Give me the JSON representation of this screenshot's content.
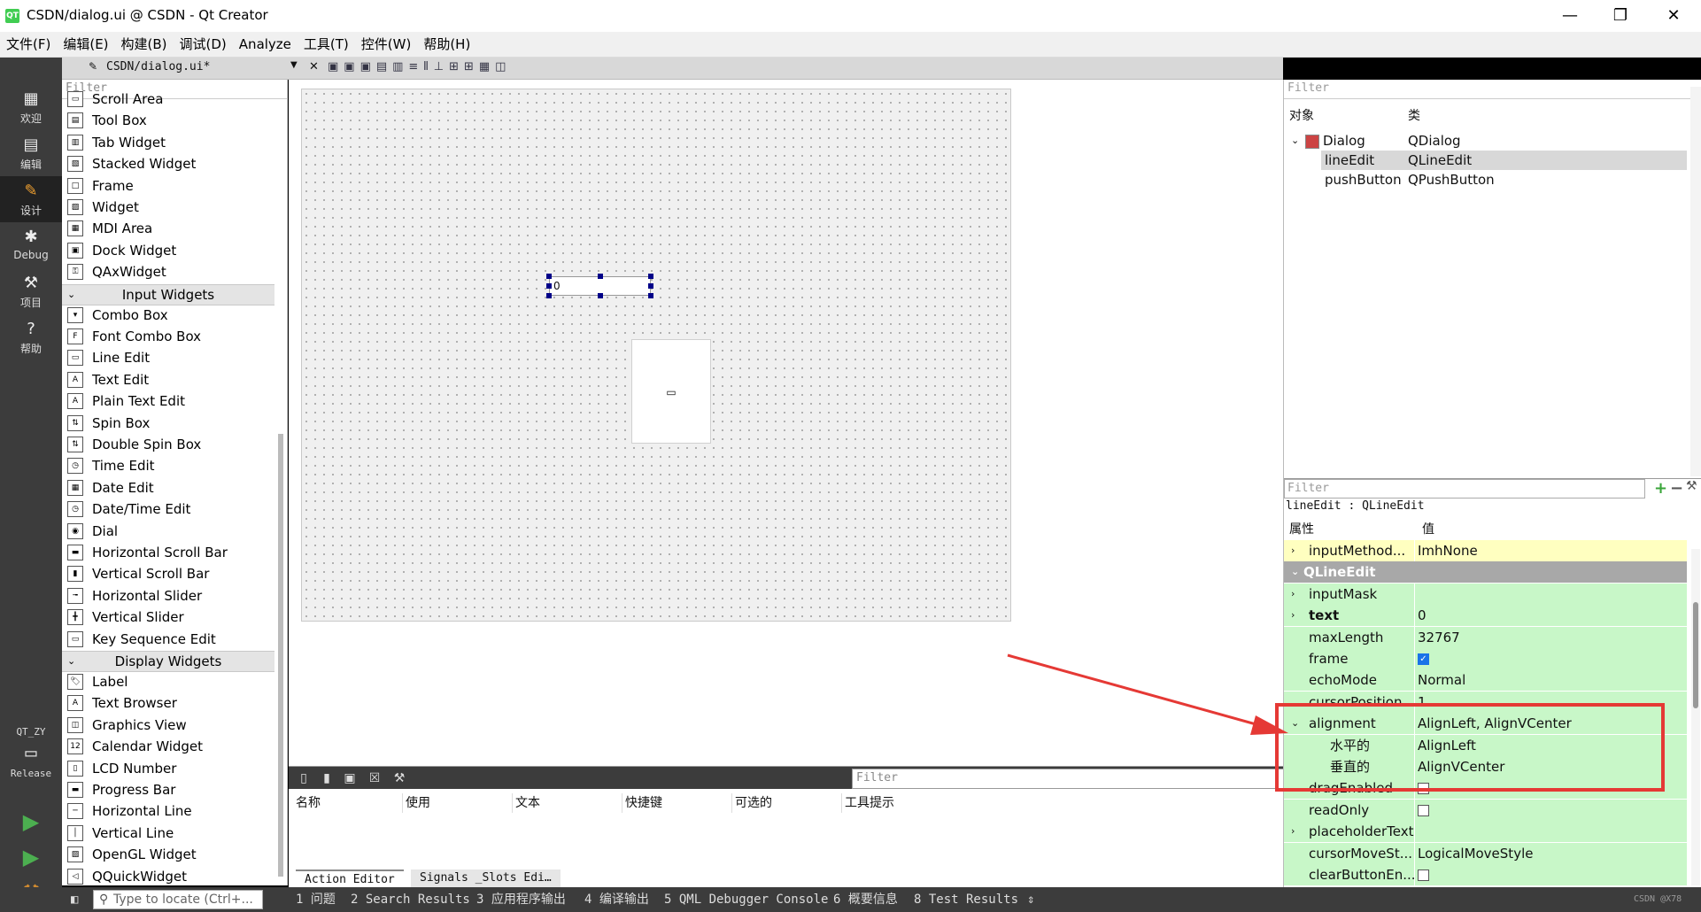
{
  "window": {
    "title": "CSDN/dialog.ui @ CSDN - Qt Creator",
    "logo": "QT",
    "min": "—",
    "max": "❐",
    "close": "✕"
  },
  "menubar": [
    "文件(F)",
    "编辑(E)",
    "构建(B)",
    "调试(D)",
    "Analyze",
    "工具(T)",
    "控件(W)",
    "帮助(H)"
  ],
  "modes": [
    {
      "label": "欢迎",
      "icon": "grid-icon"
    },
    {
      "label": "编辑",
      "icon": "document-icon"
    },
    {
      "label": "设计",
      "icon": "pencil-icon"
    },
    {
      "label": "Debug",
      "icon": "bug-icon"
    },
    {
      "label": "项目",
      "icon": "wrench-icon"
    },
    {
      "label": "帮助",
      "icon": "help-icon"
    }
  ],
  "kit": {
    "name": "QT_ZY",
    "build": "Release"
  },
  "files_bar": {
    "file": "CSDN/dialog.ui*"
  },
  "widget_box": {
    "filter_placeholder": "Filter",
    "containers": [
      "Scroll Area",
      "Tool Box",
      "Tab Widget",
      "Stacked Widget",
      "Frame",
      "Widget",
      "MDI Area",
      "Dock Widget",
      "QAxWidget"
    ],
    "input_category": "Input Widgets",
    "inputs": [
      "Combo Box",
      "Font Combo Box",
      "Line Edit",
      "Text Edit",
      "Plain Text Edit",
      "Spin Box",
      "Double Spin Box",
      "Time Edit",
      "Date Edit",
      "Date/Time Edit",
      "Dial",
      "Horizontal Scroll Bar",
      "Vertical Scroll Bar",
      "Horizontal Slider",
      "Vertical Slider",
      "Key Sequence Edit"
    ],
    "display_category": "Display Widgets",
    "displays": [
      "Label",
      "Text Browser",
      "Graphics View",
      "Calendar Widget",
      "LCD Number",
      "Progress Bar",
      "Horizontal Line",
      "Vertical Line",
      "OpenGL Widget",
      "QQuickWidget"
    ]
  },
  "form": {
    "lineedit_text": "0"
  },
  "action_editor": {
    "filter_placeholder": "Filter",
    "columns": [
      "名称",
      "使用",
      "文本",
      "快捷键",
      "可选的",
      "工具提示"
    ],
    "tabs": [
      "Action Editor",
      "Signals _Slots Edi…"
    ]
  },
  "object_inspector": {
    "filter_placeholder": "Filter",
    "headers": [
      "对象",
      "类"
    ],
    "rows": [
      {
        "object": "Dialog",
        "class": "QDialog"
      },
      {
        "object": "lineEdit",
        "class": "QLineEdit"
      },
      {
        "object": "pushButton",
        "class": "QPushButton"
      }
    ]
  },
  "property_editor": {
    "filter_placeholder": "Filter",
    "object_caption": "lineEdit : QLineEdit",
    "headers": [
      "属性",
      "值"
    ],
    "rows": [
      {
        "name": "inputMethod...",
        "value": "ImhNone",
        "exp": "›"
      },
      {
        "name": "QLineEdit",
        "value": "",
        "exp": "⌄"
      },
      {
        "name": "inputMask",
        "value": "",
        "exp": "›"
      },
      {
        "name": "text",
        "value": "0",
        "exp": "›"
      },
      {
        "name": "maxLength",
        "value": "32767",
        "exp": ""
      },
      {
        "name": "frame",
        "value": "",
        "exp": ""
      },
      {
        "name": "echoMode",
        "value": "Normal",
        "exp": ""
      },
      {
        "name": "cursorPosition",
        "value": "1",
        "exp": ""
      },
      {
        "name": "alignment",
        "value": "AlignLeft, AlignVCenter",
        "exp": "⌄"
      },
      {
        "name": "水平的",
        "value": "AlignLeft",
        "exp": ""
      },
      {
        "name": "垂直的",
        "value": "AlignVCenter",
        "exp": ""
      },
      {
        "name": "dragEnabled",
        "value": "",
        "exp": ""
      },
      {
        "name": "readOnly",
        "value": "",
        "exp": ""
      },
      {
        "name": "placeholderText",
        "value": "",
        "exp": "›"
      },
      {
        "name": "cursorMoveSt...",
        "value": "LogicalMoveStyle",
        "exp": ""
      },
      {
        "name": "clearButtonEn...",
        "value": "",
        "exp": ""
      }
    ]
  },
  "statusbar": {
    "locator_placeholder": "Type to locate (Ctrl+...",
    "panes": [
      "1 问题",
      "2 Search Results",
      "3 应用程序输出",
      "4 编译输出",
      "5 QML Debugger Console",
      "6 概要信息",
      "8 Test Results"
    ],
    "watermark": "CSDN @X78"
  },
  "colors": {
    "highlight_red": "#e53935",
    "prop_green": "#c8f7c8",
    "prop_yellow": "#ffffc0",
    "section_gray": "#a8a8a8"
  }
}
